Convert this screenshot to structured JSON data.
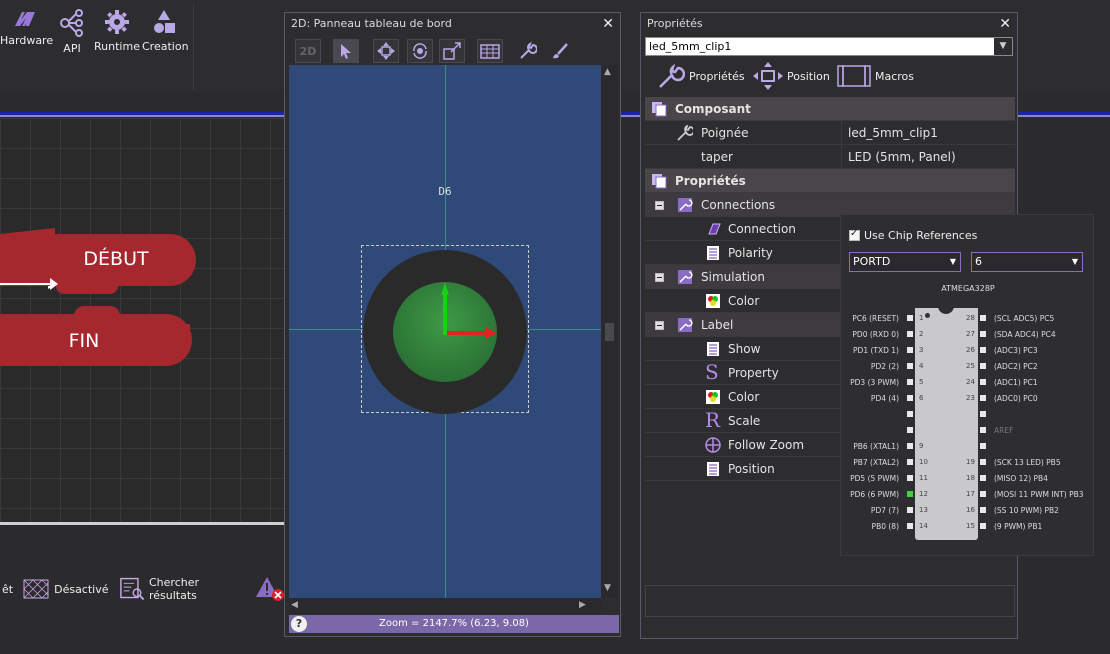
{
  "ribbon": {
    "items": [
      {
        "label": "Hardware",
        "icon": "hardware-icon"
      },
      {
        "label": "API",
        "icon": "api-icon"
      },
      {
        "label": "Runtime",
        "icon": "gear-icon"
      },
      {
        "label": "Creation",
        "icon": "shapes-icon"
      }
    ]
  },
  "flowchart": {
    "start_label": "DÉBUT",
    "end_label": "FIN"
  },
  "bottom_toolbar": {
    "left_fragment": "êt",
    "disabled_label": "Désactivé",
    "search_label": "Chercher résultats"
  },
  "panel2d": {
    "title": "2D: Panneau tableau de bord",
    "toolbar": [
      "2D",
      "select-arrow",
      "move",
      "rotate",
      "scale",
      "grid",
      "wrench",
      "brush"
    ],
    "pin_label": "D6",
    "zoom_text": "Zoom = 2147.7% (6.23, 9.08)",
    "help": "?"
  },
  "props": {
    "title": "Propriétés",
    "object_value": "led_5mm_clip1",
    "tabs": [
      {
        "label": "Propriétés",
        "icon": "wrench-icon"
      },
      {
        "label": "Position",
        "icon": "move-icon"
      },
      {
        "label": "Macros",
        "icon": "macro-icon"
      }
    ],
    "rows": [
      {
        "type": "cat",
        "label": "Composant"
      },
      {
        "type": "prop",
        "label": "Poignée",
        "value": "led_5mm_clip1"
      },
      {
        "type": "prop",
        "label": "taper",
        "value": "LED (5mm, Panel)"
      },
      {
        "type": "cat",
        "label": "Propriétés"
      },
      {
        "type": "sub",
        "label": "Connections"
      },
      {
        "type": "prop2",
        "label": "Connection"
      },
      {
        "type": "prop2",
        "label": "Polarity"
      },
      {
        "type": "sub",
        "label": "Simulation"
      },
      {
        "type": "prop2",
        "label": "Color"
      },
      {
        "type": "sub",
        "label": "Label"
      },
      {
        "type": "prop2",
        "label": "Show"
      },
      {
        "type": "prop2",
        "label": "Property"
      },
      {
        "type": "prop2",
        "label": "Color"
      },
      {
        "type": "prop2",
        "label": "Scale"
      },
      {
        "type": "prop2",
        "label": "Follow Zoom"
      },
      {
        "type": "prop2",
        "label": "Position"
      }
    ]
  },
  "chip_popup": {
    "use_chip_refs": "Use Chip References",
    "port_value": "PORTD",
    "bit_value": "6",
    "chip_name": "ATMEGA328P",
    "left_pins": [
      "PC6 (RESET)",
      "PD0 (RXD 0)",
      "PD1 (TXD 1)",
      "PD2 (2)",
      "PD3 (3 PWM)",
      "PD4 (4)",
      "",
      "",
      "PB6 (XTAL1)",
      "PB7 (XTAL2)",
      "PD5 (5 PWM)",
      "PD6 (6 PWM)",
      "PD7 (7)",
      "PB0 (8)"
    ],
    "right_pins": [
      "(SCL ADC5) PC5",
      "(SDA ADC4) PC4",
      "(ADC3) PC3",
      "(ADC2) PC2",
      "(ADC1) PC1",
      "(ADC0) PC0",
      "",
      "AREF",
      "",
      "(SCK 13 LED) PB5",
      "(MISO 12) PB4",
      "(MOSI 11 PWM INT) PB3",
      "(SS 10 PWM) PB2",
      "(9 PWM) PB1"
    ],
    "left_nums": [
      "1",
      "2",
      "3",
      "4",
      "5",
      "6",
      "",
      "",
      "9",
      "10",
      "11",
      "12",
      "13",
      "14"
    ],
    "right_nums": [
      "28",
      "27",
      "26",
      "25",
      "24",
      "23",
      "",
      "",
      "",
      "19",
      "18",
      "17",
      "16",
      "15"
    ]
  },
  "colors": {
    "accent": "#7a68a8",
    "flow_block": "#a4282d",
    "canvas": "#2f4a78"
  }
}
